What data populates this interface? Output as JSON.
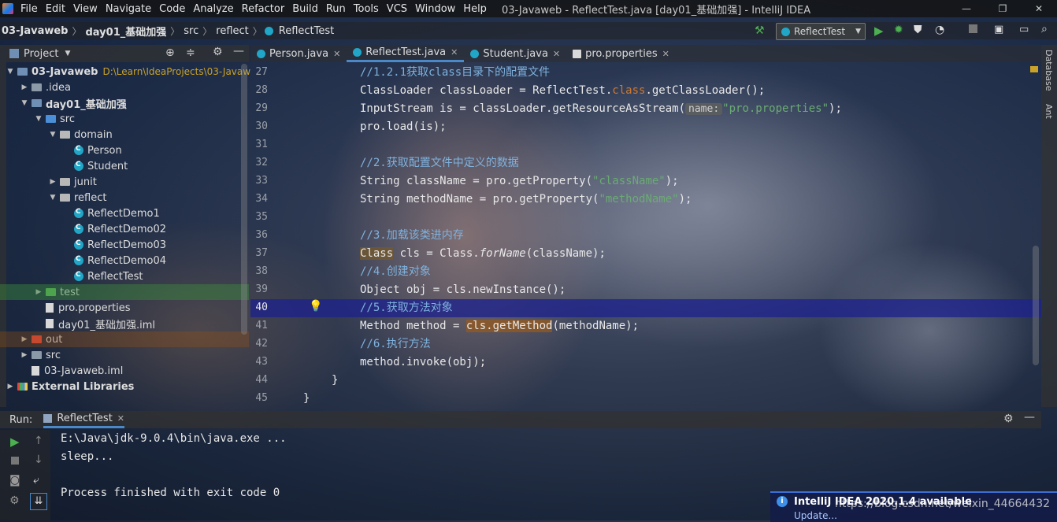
{
  "window": {
    "title": "03-Javaweb - ReflectTest.java [day01_基础加强] - IntelliJ IDEA",
    "menu": [
      "File",
      "Edit",
      "View",
      "Navigate",
      "Code",
      "Analyze",
      "Refactor",
      "Build",
      "Run",
      "Tools",
      "VCS",
      "Window",
      "Help"
    ]
  },
  "breadcrumb": [
    "03-Javaweb",
    "day01_基础加强",
    "src",
    "reflect",
    "ReflectTest"
  ],
  "run_config": "ReflectTest",
  "project": {
    "header": "Project",
    "tree": [
      {
        "label": "03-Javaweb",
        "path": "D:\\Learn\\IdeaProjects\\03-Javaw",
        "type": "module",
        "depth": 0,
        "open": true
      },
      {
        "label": ".idea",
        "type": "folder",
        "depth": 1,
        "open": false
      },
      {
        "label": "day01_基础加强",
        "type": "module",
        "depth": 1,
        "open": true
      },
      {
        "label": "src",
        "type": "src",
        "depth": 2,
        "open": true
      },
      {
        "label": "domain",
        "type": "package",
        "depth": 3,
        "open": true
      },
      {
        "label": "Person",
        "type": "class",
        "depth": 4
      },
      {
        "label": "Student",
        "type": "class",
        "depth": 4
      },
      {
        "label": "junit",
        "type": "package",
        "depth": 3,
        "open": false
      },
      {
        "label": "reflect",
        "type": "package",
        "depth": 3,
        "open": true
      },
      {
        "label": "ReflectDemo1",
        "type": "class",
        "depth": 4
      },
      {
        "label": "ReflectDemo02",
        "type": "class",
        "depth": 4
      },
      {
        "label": "ReflectDemo03",
        "type": "class",
        "depth": 4
      },
      {
        "label": "ReflectDemo04",
        "type": "class",
        "depth": 4
      },
      {
        "label": "ReflectTest",
        "type": "class",
        "depth": 4
      },
      {
        "label": "test",
        "type": "test",
        "depth": 2,
        "open": false
      },
      {
        "label": "pro.properties",
        "type": "props",
        "depth": 2
      },
      {
        "label": "day01_基础加强.iml",
        "type": "iml",
        "depth": 2
      },
      {
        "label": "out",
        "type": "out",
        "depth": 1,
        "open": false
      },
      {
        "label": "src",
        "type": "folder",
        "depth": 1,
        "open": false
      },
      {
        "label": "03-Javaweb.iml",
        "type": "iml",
        "depth": 1
      },
      {
        "label": "External Libraries",
        "type": "lib",
        "depth": 0,
        "open": false
      }
    ]
  },
  "tabs": [
    {
      "label": "Person.java",
      "active": false
    },
    {
      "label": "ReflectTest.java",
      "active": true
    },
    {
      "label": "Student.java",
      "active": false
    },
    {
      "label": "pro.properties",
      "active": false
    }
  ],
  "editor": {
    "current_line": 40,
    "lines": [
      {
        "n": "27"
      },
      {
        "n": "28"
      },
      {
        "n": "29"
      },
      {
        "n": "30"
      },
      {
        "n": "31"
      },
      {
        "n": "32"
      },
      {
        "n": "33"
      },
      {
        "n": "34"
      },
      {
        "n": "35"
      },
      {
        "n": "36"
      },
      {
        "n": "37"
      },
      {
        "n": "38"
      },
      {
        "n": "39"
      },
      {
        "n": "40"
      },
      {
        "n": "41"
      },
      {
        "n": "42"
      },
      {
        "n": "43"
      },
      {
        "n": "44"
      },
      {
        "n": "45"
      }
    ],
    "code": {
      "l27": "//1.2.1获取class目录下的配置文件",
      "l28a": "ClassLoader classLoader = ReflectTest.",
      "l28b": "class",
      "l28c": ".getClassLoader();",
      "l29a": "InputStream is = classLoader.getResourceAsStream(",
      "l29hint": "name:",
      "l29str": "\"pro.properties\"",
      "l29c": ");",
      "l30": "pro.load(is);",
      "l32": "//2.获取配置文件中定义的数据",
      "l33a": "String className = pro.getProperty(",
      "l33str": "\"className\"",
      "l33c": ");",
      "l34a": "String methodName = pro.getProperty(",
      "l34str": "\"methodName\"",
      "l34c": ");",
      "l36": "//3.加载该类进内存",
      "l37a": "Class",
      "l37b": " cls = Class.",
      "l37fn": "forName",
      "l37c": "(className);",
      "l38": "//4.创建对象",
      "l39": "Object obj = cls.newInstance();",
      "l40": "//5.获取方法对象",
      "l41a": "Method method = ",
      "l41b": "cls.getMethod",
      "l41c": "(methodName);",
      "l42": "//6.执行方法",
      "l43": "method.invoke(obj);",
      "l44": "}",
      "l45": "}"
    }
  },
  "run_panel": {
    "label": "Run:",
    "tab": "ReflectTest",
    "output": [
      "E:\\Java\\jdk-9.0.4\\bin\\java.exe ...",
      "sleep...",
      "",
      "Process finished with exit code 0"
    ]
  },
  "right_stripe": [
    "Database",
    "Ant"
  ],
  "notification": {
    "title": "IntelliJ IDEA 2020.1.4 available",
    "link": "Update...",
    "watermark": "https://blog.csdn.net/weixin_44664432"
  },
  "colors": {
    "accent": "#4a88c7",
    "current_line": "#1e238c",
    "comment": "#7fb2de",
    "string": "#6aab73",
    "keyword": "#cc7832"
  }
}
